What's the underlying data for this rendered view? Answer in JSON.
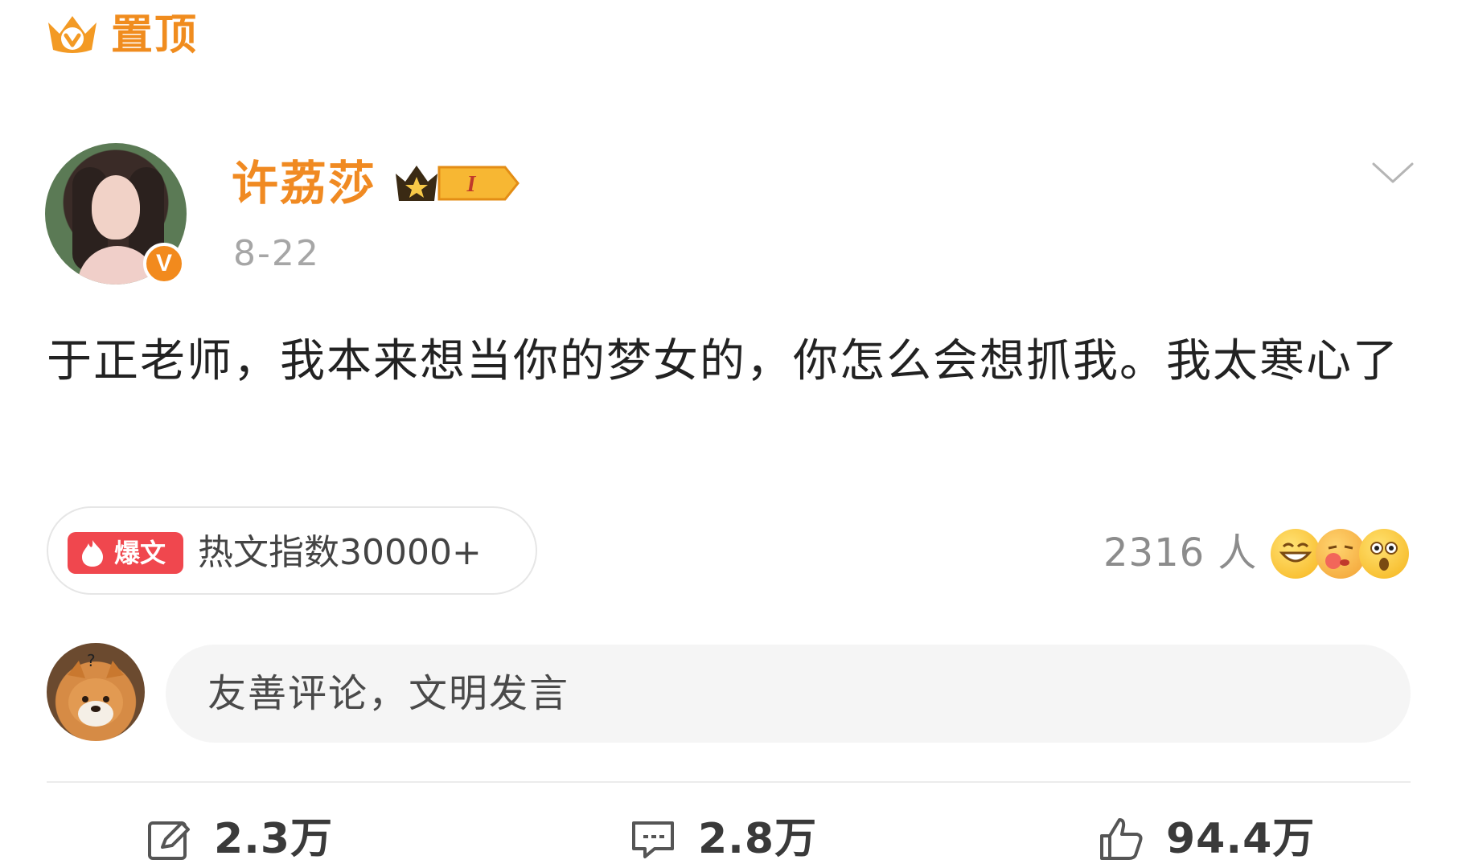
{
  "pinned": {
    "label": "置顶"
  },
  "author": {
    "name": "许荔莎",
    "date": "8-22",
    "vip_level": "I",
    "verified_mark": "V"
  },
  "post": {
    "text": "于正老师，我本来想当你的梦女的，你怎么会想抓我。我太寒心了"
  },
  "hot": {
    "badge": "爆文",
    "text": "热文指数30000+"
  },
  "reactions": {
    "count": "2316 人",
    "emojis": [
      "grin-emoji",
      "kiss-emoji",
      "shocked-emoji"
    ]
  },
  "comment": {
    "placeholder": "友善评论，文明发言"
  },
  "actions": {
    "repost": "2.3万",
    "comment": "2.8万",
    "like": "94.4万"
  },
  "colors": {
    "accent": "#f08a22",
    "hot_red": "#f0474e",
    "muted": "#a6a6a6"
  }
}
